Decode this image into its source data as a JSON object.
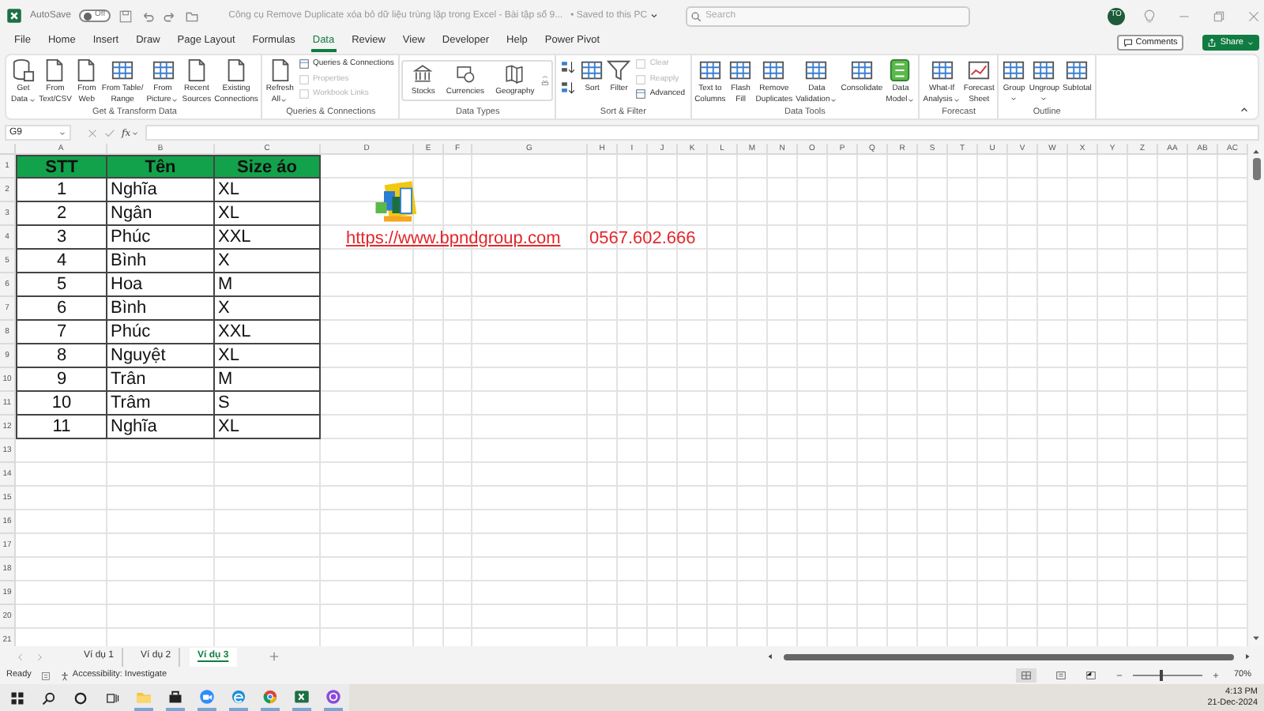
{
  "title_bar": {
    "autosave_label": "AutoSave",
    "autosave": {
      "on": false,
      "label": "Off"
    },
    "document_title": "Công cụ Remove Duplicate xóa bỏ dữ liệu trùng lặp trong Excel - Bài tập số 9...",
    "save_status": "• Saved to this PC",
    "search": {
      "placeholder": "Search"
    },
    "avatar": "TO"
  },
  "ribbon": {
    "tabs": [
      {
        "label": "File",
        "selected": false
      },
      {
        "label": "Home",
        "selected": false
      },
      {
        "label": "Insert",
        "selected": false
      },
      {
        "label": "Draw",
        "selected": false
      },
      {
        "label": "Page Layout",
        "selected": false
      },
      {
        "label": "Formulas",
        "selected": false
      },
      {
        "label": "Data",
        "selected": true
      },
      {
        "label": "Review",
        "selected": false
      },
      {
        "label": "View",
        "selected": false
      },
      {
        "label": "Developer",
        "selected": false
      },
      {
        "label": "Help",
        "selected": false
      },
      {
        "label": "Power Pivot",
        "selected": false
      }
    ],
    "comments_button": "Comments",
    "share_button": "Share",
    "groups": [
      {
        "label": "Get & Transform Data",
        "items": [
          {
            "kind": "large",
            "lines": [
              "Get",
              "Data"
            ],
            "dropdown": true
          },
          {
            "kind": "large",
            "lines": [
              "From",
              "Text/CSV"
            ],
            "dropdown": false
          },
          {
            "kind": "large",
            "lines": [
              "From",
              "Web"
            ],
            "dropdown": false
          },
          {
            "kind": "large",
            "lines": [
              "From Table/",
              "Range"
            ],
            "dropdown": false
          },
          {
            "kind": "large",
            "lines": [
              "From",
              "Picture"
            ],
            "dropdown": true
          },
          {
            "kind": "large",
            "lines": [
              "Recent",
              "Sources"
            ],
            "dropdown": false
          },
          {
            "kind": "large",
            "lines": [
              "Existing",
              "Connections"
            ],
            "dropdown": false
          }
        ]
      },
      {
        "label": "Queries & Connections",
        "items": [
          {
            "kind": "large",
            "lines": [
              "Refresh",
              "All"
            ],
            "dropdown": true
          },
          {
            "kind": "stack",
            "items": [
              {
                "label": "Queries & Connections",
                "disabled": false
              },
              {
                "label": "Properties",
                "disabled": true
              },
              {
                "label": "Workbook Links",
                "disabled": true
              }
            ]
          }
        ]
      },
      {
        "label": "Data Types",
        "items": [
          {
            "kind": "gallery",
            "items": [
              "Stocks",
              "Currencies",
              "Geography"
            ]
          }
        ]
      },
      {
        "label": "Sort & Filter",
        "items": [
          {
            "kind": "sort_icons"
          },
          {
            "kind": "large",
            "lines": [
              "Sort"
            ],
            "dropdown": false
          },
          {
            "kind": "large",
            "lines": [
              "Filter"
            ],
            "dropdown": false
          },
          {
            "kind": "stack",
            "items": [
              {
                "label": "Clear",
                "disabled": true
              },
              {
                "label": "Reapply",
                "disabled": true
              },
              {
                "label": "Advanced",
                "disabled": false
              }
            ]
          }
        ]
      },
      {
        "label": "Data Tools",
        "items": [
          {
            "kind": "large",
            "lines": [
              "Text to",
              "Columns"
            ],
            "dropdown": false
          },
          {
            "kind": "large",
            "lines": [
              "Flash",
              "Fill"
            ],
            "dropdown": false
          },
          {
            "kind": "large",
            "lines": [
              "Remove",
              "Duplicates"
            ],
            "dropdown": false
          },
          {
            "kind": "large",
            "lines": [
              "Data",
              "Validation"
            ],
            "dropdown": true
          },
          {
            "kind": "large",
            "lines": [
              "Consolidate"
            ],
            "dropdown": false
          },
          {
            "kind": "large",
            "lines": [
              "Data",
              "Model"
            ],
            "dropdown": true
          }
        ]
      },
      {
        "label": "Forecast",
        "items": [
          {
            "kind": "large",
            "lines": [
              "What-If",
              "Analysis"
            ],
            "dropdown": true
          },
          {
            "kind": "large",
            "lines": [
              "Forecast",
              "Sheet"
            ],
            "dropdown": false
          }
        ]
      },
      {
        "label": "Outline",
        "items": [
          {
            "kind": "large",
            "lines": [
              "Group"
            ],
            "dropdown": true
          },
          {
            "kind": "large",
            "lines": [
              "Ungroup"
            ],
            "dropdown": true
          },
          {
            "kind": "large",
            "lines": [
              "Subtotal"
            ],
            "dropdown": false
          }
        ]
      }
    ]
  },
  "formula_bar": {
    "name_box": "G9",
    "function_label": "fx"
  },
  "sheet": {
    "columns": [
      "A",
      "B",
      "C",
      "D",
      "E",
      "F",
      "G",
      "H",
      "I",
      "J",
      "K",
      "L",
      "M",
      "N",
      "O",
      "P",
      "Q",
      "R",
      "S",
      "T",
      "U",
      "V",
      "W",
      "X",
      "Y",
      "Z",
      "AA",
      "AB",
      "AC"
    ],
    "rows": [
      "1",
      "2",
      "3",
      "4",
      "5",
      "6",
      "7",
      "8",
      "9",
      "10",
      "11",
      "12",
      "13",
      "14",
      "15",
      "16",
      "17",
      "18",
      "19",
      "20",
      "21"
    ],
    "table": {
      "header": [
        "STT",
        "Tên",
        "Size áo"
      ],
      "rows": [
        [
          "1",
          "Nghĩa",
          "XL"
        ],
        [
          "2",
          "Ngân",
          "XL"
        ],
        [
          "3",
          "Phúc",
          "XXL"
        ],
        [
          "4",
          "Bình",
          "X"
        ],
        [
          "5",
          "Hoa",
          "M"
        ],
        [
          "6",
          "Bình",
          "X"
        ],
        [
          "7",
          "Phúc",
          "XXL"
        ],
        [
          "8",
          "Nguyệt",
          "XL"
        ],
        [
          "9",
          "Trân",
          "M"
        ],
        [
          "10",
          "Trâm",
          "S"
        ],
        [
          "11",
          "Nghĩa",
          "XL"
        ]
      ]
    },
    "link": "https://www.bpndgroup.com",
    "phone": "0567.602.666"
  },
  "sheet_tabs": [
    {
      "label": "Ví dụ 1",
      "selected": false
    },
    {
      "label": "Ví dụ 2",
      "selected": false
    },
    {
      "label": "Ví dụ 3",
      "selected": true
    }
  ],
  "status_bar": {
    "status": "Ready",
    "accessibility": "Accessibility: Investigate",
    "zoom": {
      "level": 0.4,
      "reading": "70%"
    }
  },
  "taskbar": {
    "time": "4:13 PM",
    "date": "21-Dec-2024"
  }
}
